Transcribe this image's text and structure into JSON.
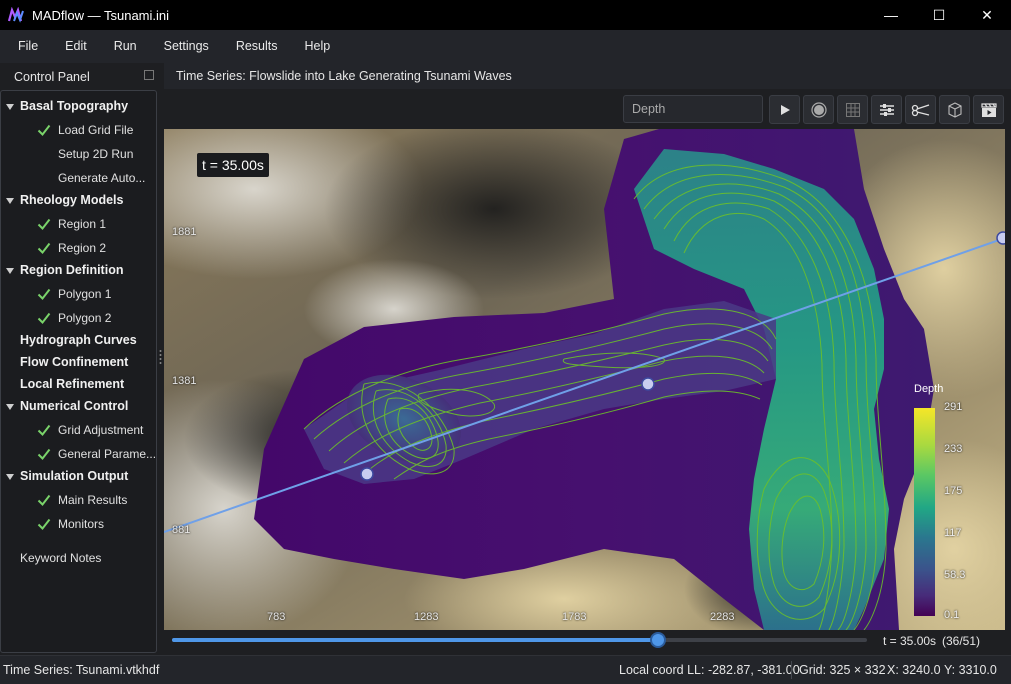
{
  "window": {
    "title": "MADflow — Tsunami.ini",
    "minimize": "—",
    "maximize": "☐",
    "close": "✕"
  },
  "menu": [
    "File",
    "Edit",
    "Run",
    "Settings",
    "Results",
    "Help"
  ],
  "panel": {
    "title": "Control Panel",
    "tree": [
      {
        "label": "Basal Topography",
        "bold": true,
        "expand": true
      },
      {
        "label": "Load Grid File",
        "check": true
      },
      {
        "label": "Setup 2D Run",
        "check": false
      },
      {
        "label": "Generate Auto...",
        "check": false
      },
      {
        "label": "Rheology Models",
        "bold": true,
        "expand": true
      },
      {
        "label": "Region 1",
        "check": true
      },
      {
        "label": "Region 2",
        "check": true
      },
      {
        "label": "Region Definition",
        "bold": true,
        "expand": true
      },
      {
        "label": "Polygon 1",
        "check": true
      },
      {
        "label": "Polygon 2",
        "check": true
      },
      {
        "label": "Hydrograph Curves",
        "bold": true,
        "expand": false
      },
      {
        "label": "Flow Confinement",
        "bold": true,
        "expand": false
      },
      {
        "label": "Local Refinement",
        "bold": true,
        "expand": false
      },
      {
        "label": "Numerical Control",
        "bold": true,
        "expand": true
      },
      {
        "label": "Grid Adjustment",
        "check": true
      },
      {
        "label": "General Parame...",
        "check": true
      },
      {
        "label": "Simulation Output",
        "bold": true,
        "expand": true
      },
      {
        "label": "Main Results",
        "check": true
      },
      {
        "label": "Monitors",
        "check": true
      },
      {
        "label": "Keyword Notes",
        "bold": false,
        "plain": true
      }
    ]
  },
  "view": {
    "title": "Time Series: Flowslide into Lake Generating Tsunami Waves",
    "field_selector": "Depth",
    "toolbar": [
      "play-icon",
      "record-icon",
      "grid-icon",
      "filter-icon",
      "profile-line-icon",
      "cube-icon",
      "clapper-icon"
    ]
  },
  "map": {
    "time_label": "t = 35.00s",
    "x_ticks": [
      "783",
      "1283",
      "1783",
      "2283"
    ],
    "y_ticks": [
      "1881",
      "1381",
      "881"
    ],
    "colorbar": {
      "title": "Depth",
      "ticks": [
        "291",
        "233",
        "175",
        "117",
        "58.3",
        "0.1"
      ],
      "colors": [
        "#f5e628",
        "#5cc863",
        "#21a785",
        "#2a788e",
        "#3b528b",
        "#440154"
      ]
    }
  },
  "playback": {
    "time": "t = 35.00s",
    "frame": "(36/51)",
    "current_frame": 36,
    "total_frames": 51
  },
  "status": {
    "file": "Time Series: Tsunami.vtkhdf",
    "local_coord": "Local coord LL: -282.87, -381.00",
    "grid": "Grid: 325 × 332",
    "x": "X: 3240.0",
    "y": "Y: 3310.0"
  }
}
